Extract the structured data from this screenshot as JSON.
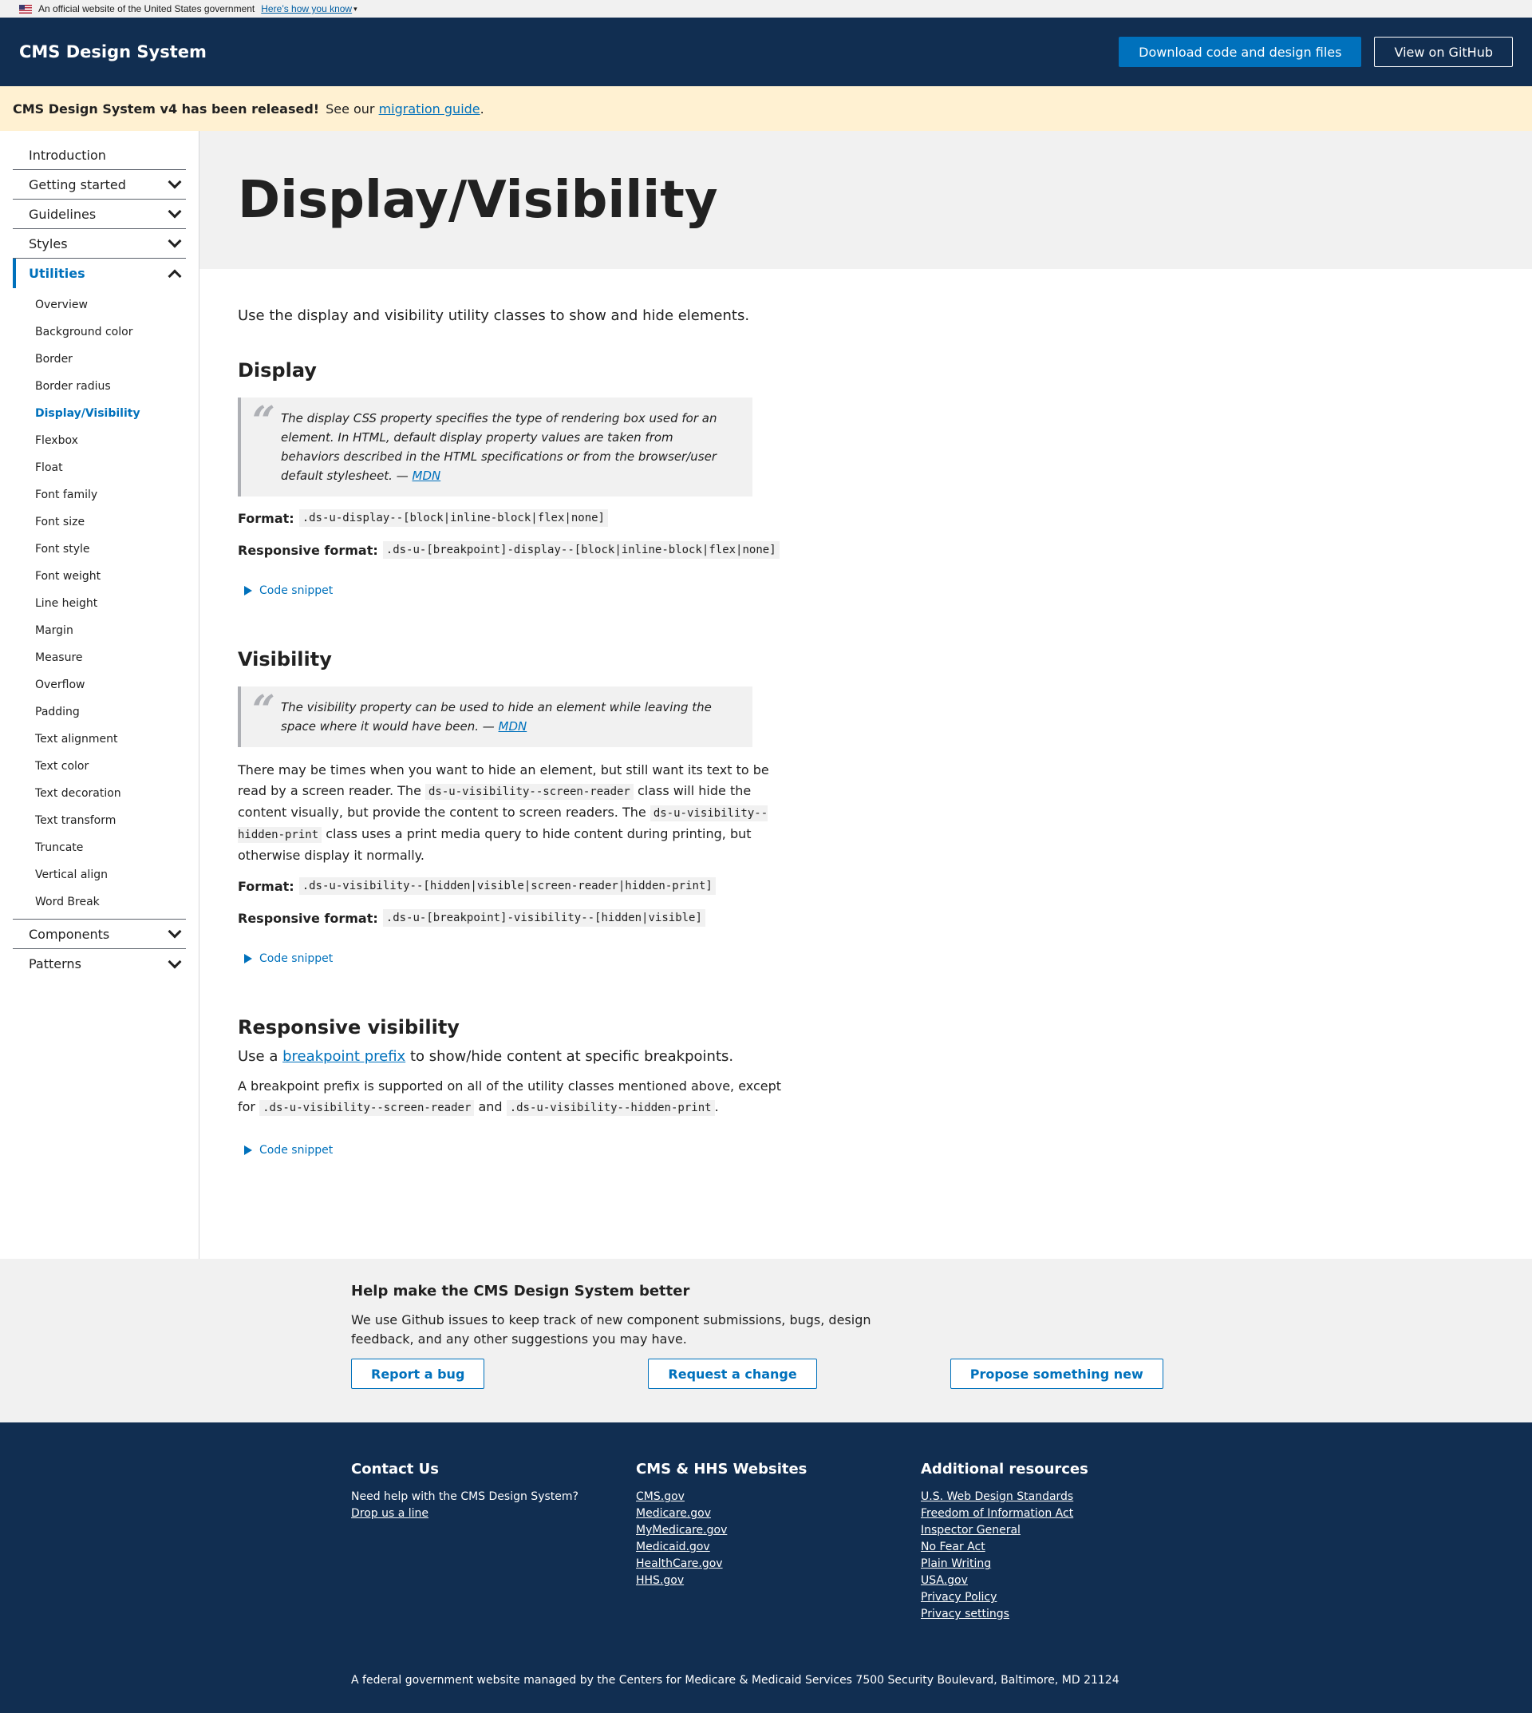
{
  "gov_banner": {
    "text": "An official website of the United States government",
    "link": "Here’s how you know"
  },
  "header": {
    "brand": "CMS Design System",
    "download_label": "Download code and design files",
    "github_label": "View on GitHub"
  },
  "release": {
    "strong": "CMS Design System v4 has been released!",
    "text_before": "See our",
    "link": "migration guide",
    "text_after": "."
  },
  "sidebar": {
    "top_items": [
      {
        "label": "Introduction"
      },
      {
        "label": "Getting started"
      },
      {
        "label": "Guidelines"
      },
      {
        "label": "Styles"
      },
      {
        "label": "Utilities"
      }
    ],
    "sub_items": [
      "Overview",
      "Background color",
      "Border",
      "Border radius",
      "Display/Visibility",
      "Flexbox",
      "Float",
      "Font family",
      "Font size",
      "Font style",
      "Font weight",
      "Line height",
      "Margin",
      "Measure",
      "Overflow",
      "Padding",
      "Text alignment",
      "Text color",
      "Text decoration",
      "Text transform",
      "Truncate",
      "Vertical align",
      "Word Break"
    ],
    "bottom_items": [
      {
        "label": "Components"
      },
      {
        "label": "Patterns"
      }
    ]
  },
  "page": {
    "title": "Display/Visibility",
    "lead": "Use the display and visibility utility classes to show and hide elements."
  },
  "display": {
    "heading": "Display",
    "quote": "The display CSS property specifies the type of rendering box used for an element. In HTML, default display property values are taken from behaviors described in the HTML specifications or from the browser/user default stylesheet. —",
    "quote_link": "MDN",
    "format_label": "Format",
    "format_code": ".ds-u-display--[block|inline-block|flex|none]",
    "responsive_label": "Responsive format",
    "responsive_code": ".ds-u-[breakpoint]-display--[block|inline-block|flex|none]",
    "snippet": "Code snippet"
  },
  "visibility": {
    "heading": "Visibility",
    "quote": "The visibility property can be used to hide an element while leaving the space where it would have been. —",
    "quote_link": "MDN",
    "p1": "There may be times when you want to hide an element, but still want its text to be read by a screen reader. The",
    "code1": "ds-u-visibility--screen-reader",
    "p2": "class will hide the content visually, but provide the content to screen readers. The",
    "code2": "ds-u-visibility--hidden-print",
    "p3": "class uses a print media query to hide content during printing, but otherwise display it normally.",
    "format_label": "Format",
    "format_code": ".ds-u-visibility--[hidden|visible|screen-reader|hidden-print]",
    "responsive_label": "Responsive format",
    "responsive_code": ".ds-u-[breakpoint]-visibility--[hidden|visible]",
    "snippet": "Code snippet"
  },
  "responsive": {
    "heading": "Responsive visibility",
    "lead_before": "Use a",
    "lead_link": "breakpoint prefix",
    "lead_after": "to show/hide content at specific breakpoints.",
    "p1": "A breakpoint prefix is supported on all of the utility classes mentioned above, except for",
    "code1": ".ds-u-visibility--screen-reader",
    "and": "and",
    "code2": ".ds-u-visibility--hidden-print",
    "end": ".",
    "snippet": "Code snippet"
  },
  "help": {
    "heading": "Help make the CMS Design System better",
    "text": "We use Github issues to keep track of new component submissions, bugs, design feedback, and any other suggestions you may have.",
    "buttons": [
      "Report a bug",
      "Request a change",
      "Propose something new"
    ]
  },
  "footer": {
    "contact": {
      "heading": "Contact Us",
      "text": "Need help with the CMS Design System?",
      "link": "Drop us a line"
    },
    "websites": {
      "heading": "CMS & HHS Websites",
      "links": [
        "CMS.gov",
        "Medicare.gov",
        "MyMedicare.gov",
        "Medicaid.gov",
        "HealthCare.gov",
        "HHS.gov"
      ]
    },
    "resources": {
      "heading": "Additional resources",
      "links": [
        "U.S. Web Design Standards",
        "Freedom of Information Act",
        "Inspector General",
        "No Fear Act",
        "Plain Writing",
        "USA.gov",
        "Privacy Policy",
        "Privacy settings"
      ]
    },
    "note": "A federal government website managed by the Centers for Medicare & Medicaid Services 7500 Security Boulevard, Baltimore, MD 21124"
  },
  "colors": {
    "navy": "#112e51",
    "primary": "#0071bc",
    "release_bg": "#fff1d2",
    "gray_bg": "#f1f1f1"
  }
}
